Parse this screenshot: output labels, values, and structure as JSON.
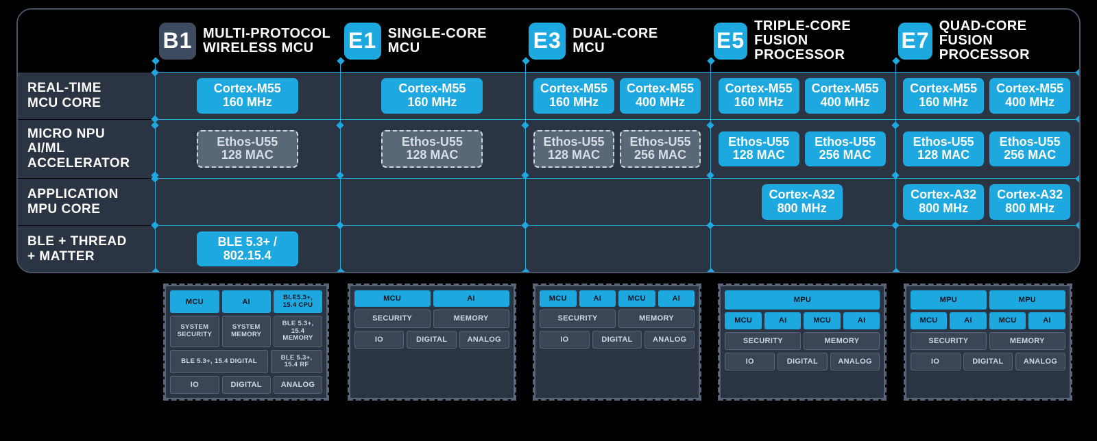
{
  "rows": {
    "r1": {
      "l1": "REAL-TIME",
      "l2": "MCU CORE"
    },
    "r2": {
      "l1": "MICRO NPU AI/ML",
      "l2": "ACCELERATOR"
    },
    "r3": {
      "l1": "APPLICATION",
      "l2": "MPU CORE"
    },
    "r4": {
      "l1": "BLE + THREAD",
      "l2": "+ MATTER"
    }
  },
  "cols": [
    {
      "id": "B1",
      "title1": "MULTI-PROTOCOL",
      "title2": "WIRELESS MCU",
      "style": "dark"
    },
    {
      "id": "E1",
      "title1": "SINGLE-CORE",
      "title2": "MCU",
      "style": "blue"
    },
    {
      "id": "E3",
      "title1": "DUAL-CORE",
      "title2": "MCU",
      "style": "blue"
    },
    {
      "id": "E5",
      "title1": "TRIPLE-CORE",
      "title2": "FUSION PROCESSOR",
      "style": "blue"
    },
    {
      "id": "E7",
      "title1": "QUAD-CORE",
      "title2": "FUSION PROCESSOR",
      "style": "blue"
    }
  ],
  "cells": {
    "B1": {
      "mcu": [
        {
          "n": "Cortex-M55",
          "f": "160 MHz"
        }
      ],
      "ai": [
        {
          "n": "Ethos-U55",
          "f": "128 MAC",
          "ghost": true
        }
      ],
      "app": [],
      "ble": [
        {
          "n": "BLE 5.3+ /",
          "f": "802.15.4"
        }
      ]
    },
    "E1": {
      "mcu": [
        {
          "n": "Cortex-M55",
          "f": "160 MHz"
        }
      ],
      "ai": [
        {
          "n": "Ethos-U55",
          "f": "128 MAC",
          "ghost": true
        }
      ],
      "app": [],
      "ble": []
    },
    "E3": {
      "mcu": [
        {
          "n": "Cortex-M55",
          "f": "160 MHz"
        },
        {
          "n": "Cortex-M55",
          "f": "400 MHz"
        }
      ],
      "ai": [
        {
          "n": "Ethos-U55",
          "f": "128 MAC",
          "ghost": true
        },
        {
          "n": "Ethos-U55",
          "f": "256 MAC",
          "ghost": true
        }
      ],
      "app": [],
      "ble": []
    },
    "E5": {
      "mcu": [
        {
          "n": "Cortex-M55",
          "f": "160 MHz"
        },
        {
          "n": "Cortex-M55",
          "f": "400 MHz"
        }
      ],
      "ai": [
        {
          "n": "Ethos-U55",
          "f": "128 MAC"
        },
        {
          "n": "Ethos-U55",
          "f": "256 MAC"
        }
      ],
      "app": [
        {
          "n": "Cortex-A32",
          "f": "800 MHz"
        }
      ],
      "ble": []
    },
    "E7": {
      "mcu": [
        {
          "n": "Cortex-M55",
          "f": "160 MHz"
        },
        {
          "n": "Cortex-M55",
          "f": "400 MHz"
        }
      ],
      "ai": [
        {
          "n": "Ethos-U55",
          "f": "128 MAC"
        },
        {
          "n": "Ethos-U55",
          "f": "256 MAC"
        }
      ],
      "app": [
        {
          "n": "Cortex-A32",
          "f": "800 MHz"
        },
        {
          "n": "Cortex-A32",
          "f": "800 MHz"
        }
      ],
      "ble": []
    }
  },
  "chips": [
    {
      "rows": [
        [
          {
            "t": "MCU",
            "c": "blue"
          },
          {
            "t": "AI",
            "c": "blue"
          },
          {
            "t": "BLE5.3+, 15.4 CPU",
            "c": "blue",
            "sm": true
          }
        ],
        [
          {
            "t": "SYSTEM SECURITY",
            "c": "gray",
            "sm": true
          },
          {
            "t": "SYSTEM MEMORY",
            "c": "gray",
            "sm": true
          },
          {
            "t": "BLE 5.3+, 15.4 MEMORY",
            "c": "gray",
            "sm": true
          }
        ],
        [
          {
            "t": "BLE 5.3+, 15.4 DIGITAL",
            "c": "gray",
            "sm": true,
            "span": 2
          },
          {
            "t": "BLE 5.3+, 15.4 RF",
            "c": "gray",
            "sm": true
          }
        ],
        [
          {
            "t": "IO",
            "c": "gray"
          },
          {
            "t": "DIGITAL",
            "c": "gray"
          },
          {
            "t": "ANALOG",
            "c": "gray"
          }
        ]
      ]
    },
    {
      "rows": [
        [
          {
            "t": "MCU",
            "c": "blue"
          },
          {
            "t": "AI",
            "c": "blue"
          }
        ],
        [
          {
            "t": "SECURITY",
            "c": "gray"
          },
          {
            "t": "MEMORY",
            "c": "gray"
          }
        ],
        [
          {
            "t": "IO",
            "c": "gray"
          },
          {
            "t": "DIGITAL",
            "c": "gray"
          },
          {
            "t": "ANALOG",
            "c": "gray"
          }
        ]
      ]
    },
    {
      "rows": [
        [
          {
            "t": "MCU",
            "c": "blue"
          },
          {
            "t": "AI",
            "c": "blue"
          },
          {
            "t": "MCU",
            "c": "blue"
          },
          {
            "t": "AI",
            "c": "blue"
          }
        ],
        [
          {
            "t": "SECURITY",
            "c": "gray"
          },
          {
            "t": "MEMORY",
            "c": "gray"
          }
        ],
        [
          {
            "t": "IO",
            "c": "gray"
          },
          {
            "t": "DIGITAL",
            "c": "gray"
          },
          {
            "t": "ANALOG",
            "c": "gray"
          }
        ]
      ]
    },
    {
      "rows": [
        [
          {
            "t": "MPU",
            "c": "blue",
            "mpu": true
          }
        ],
        [
          {
            "t": "MCU",
            "c": "blue"
          },
          {
            "t": "AI",
            "c": "blue"
          },
          {
            "t": "MCU",
            "c": "blue"
          },
          {
            "t": "AI",
            "c": "blue"
          }
        ],
        [
          {
            "t": "SECURITY",
            "c": "gray"
          },
          {
            "t": "MEMORY",
            "c": "gray"
          }
        ],
        [
          {
            "t": "IO",
            "c": "gray"
          },
          {
            "t": "DIGITAL",
            "c": "gray"
          },
          {
            "t": "ANALOG",
            "c": "gray"
          }
        ]
      ]
    },
    {
      "rows": [
        [
          {
            "t": "MPU",
            "c": "blue",
            "mpu": true
          },
          {
            "t": "MPU",
            "c": "blue",
            "mpu": true
          }
        ],
        [
          {
            "t": "MCU",
            "c": "blue"
          },
          {
            "t": "AI",
            "c": "blue"
          },
          {
            "t": "MCU",
            "c": "blue"
          },
          {
            "t": "AI",
            "c": "blue"
          }
        ],
        [
          {
            "t": "SECURITY",
            "c": "gray"
          },
          {
            "t": "MEMORY",
            "c": "gray"
          }
        ],
        [
          {
            "t": "IO",
            "c": "gray"
          },
          {
            "t": "DIGITAL",
            "c": "gray"
          },
          {
            "t": "ANALOG",
            "c": "gray"
          }
        ]
      ]
    }
  ]
}
